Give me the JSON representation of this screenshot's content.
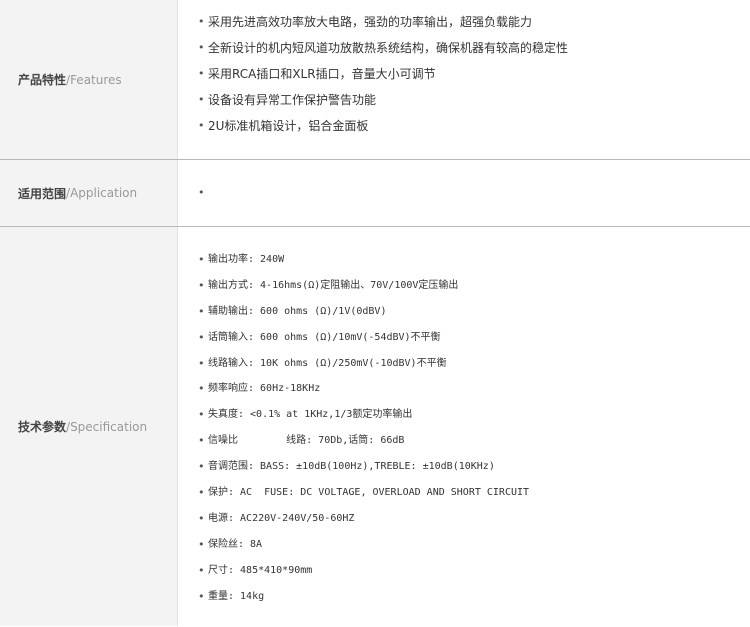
{
  "sections": [
    {
      "label_zh": "产品特性",
      "label_sep": "/",
      "label_en": "Features",
      "items": [
        "采用先进高效功率放大电路，强劲的功率输出，超强负载能力",
        "全新设计的机内短风道功放散热系统结构，确保机器有较高的稳定性",
        "采用RCA插口和XLR插口，音量大小可调节",
        "设备设有异常工作保护警告功能",
        "2U标准机箱设计，铝合金面板"
      ]
    },
    {
      "label_zh": "适用范围",
      "label_sep": "/",
      "label_en": "Application",
      "items": [
        ""
      ]
    },
    {
      "label_zh": "技术参数",
      "label_sep": "/",
      "label_en": "Specification",
      "items": [
        "输出功率: 240W",
        "输出方式: 4-16hms(Ω)定阻输出、70V/100V定压输出",
        "辅助输出: 600 ohms (Ω)/1V(0dBV)",
        "话筒输入: 600 ohms (Ω)/10mV(-54dBV)不平衡",
        "线路输入: 10K ohms (Ω)/250mV(-10dBV)不平衡",
        "频率响应: 60Hz-18KHz",
        "失真度: <0.1% at 1KHz,1/3额定功率输出",
        "信噪比        线路: 70Db,话筒: 66dB",
        "音调范围: BASS: ±10dB(100Hz),TREBLE: ±10dB(10KHz)",
        "保护: AC  FUSE: DC VOLTAGE, OVERLOAD AND SHORT CIRCUIT",
        "电源: AC220V-240V/50-60HZ",
        "保险丝: 8A",
        "尺寸: 485*410*90mm",
        "重量: 14kg"
      ]
    }
  ]
}
